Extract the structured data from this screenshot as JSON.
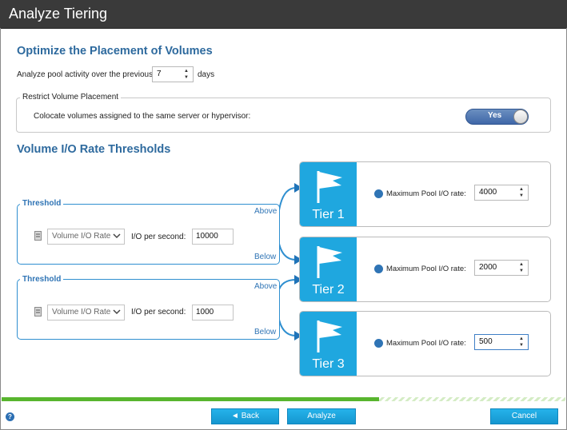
{
  "window": {
    "title": "Analyze Tiering"
  },
  "optimize": {
    "heading": "Optimize the Placement of Volumes",
    "analyze_label": "Analyze pool activity over the previous",
    "days_value": "7",
    "days_unit": "days"
  },
  "restrict": {
    "legend": "Restrict Volume Placement",
    "colocate_label": "Colocate volumes assigned to the same server or hypervisor:",
    "toggle_label": "Yes"
  },
  "thresholds": {
    "heading": "Volume I/O Rate Thresholds",
    "items": [
      {
        "legend": "Threshold",
        "metric": "Volume I/O Rate",
        "io_label": "I/O per second:",
        "io_value": "10000",
        "above": "Above",
        "below": "Below"
      },
      {
        "legend": "Threshold",
        "metric": "Volume I/O Rate",
        "io_label": "I/O per second:",
        "io_value": "1000",
        "above": "Above",
        "below": "Below"
      }
    ]
  },
  "tiers": [
    {
      "name": "Tier 1",
      "max_label": "Maximum Pool I/O rate:",
      "max_value": "4000"
    },
    {
      "name": "Tier 2",
      "max_label": "Maximum Pool I/O rate:",
      "max_value": "2000"
    },
    {
      "name": "Tier 3",
      "max_label": "Maximum Pool I/O rate:",
      "max_value": "500"
    }
  ],
  "progress": {
    "fraction": 0.67
  },
  "footer": {
    "help": "?",
    "back": "◄ Back",
    "analyze": "Analyze",
    "cancel": "Cancel"
  },
  "colors": {
    "accent": "#1fa7df",
    "heading": "#2e6a9e",
    "progress": "#58b52e",
    "title_bar": "#3a3a3a"
  }
}
